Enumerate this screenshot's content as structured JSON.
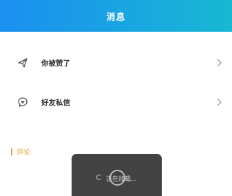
{
  "header": {
    "title": "消息"
  },
  "rows": [
    {
      "label": "你被赞了",
      "icon": "paper-plane-icon"
    },
    {
      "label": "好友私信",
      "icon": "chat-heart-icon"
    }
  ],
  "section": {
    "label": "评论"
  },
  "toast": {
    "text": "正在加载..."
  },
  "colors": {
    "header_start": "#1a8ff0",
    "header_end": "#18b8d2",
    "section_accent": "#e3a23a",
    "toast_bg": "#282828"
  }
}
